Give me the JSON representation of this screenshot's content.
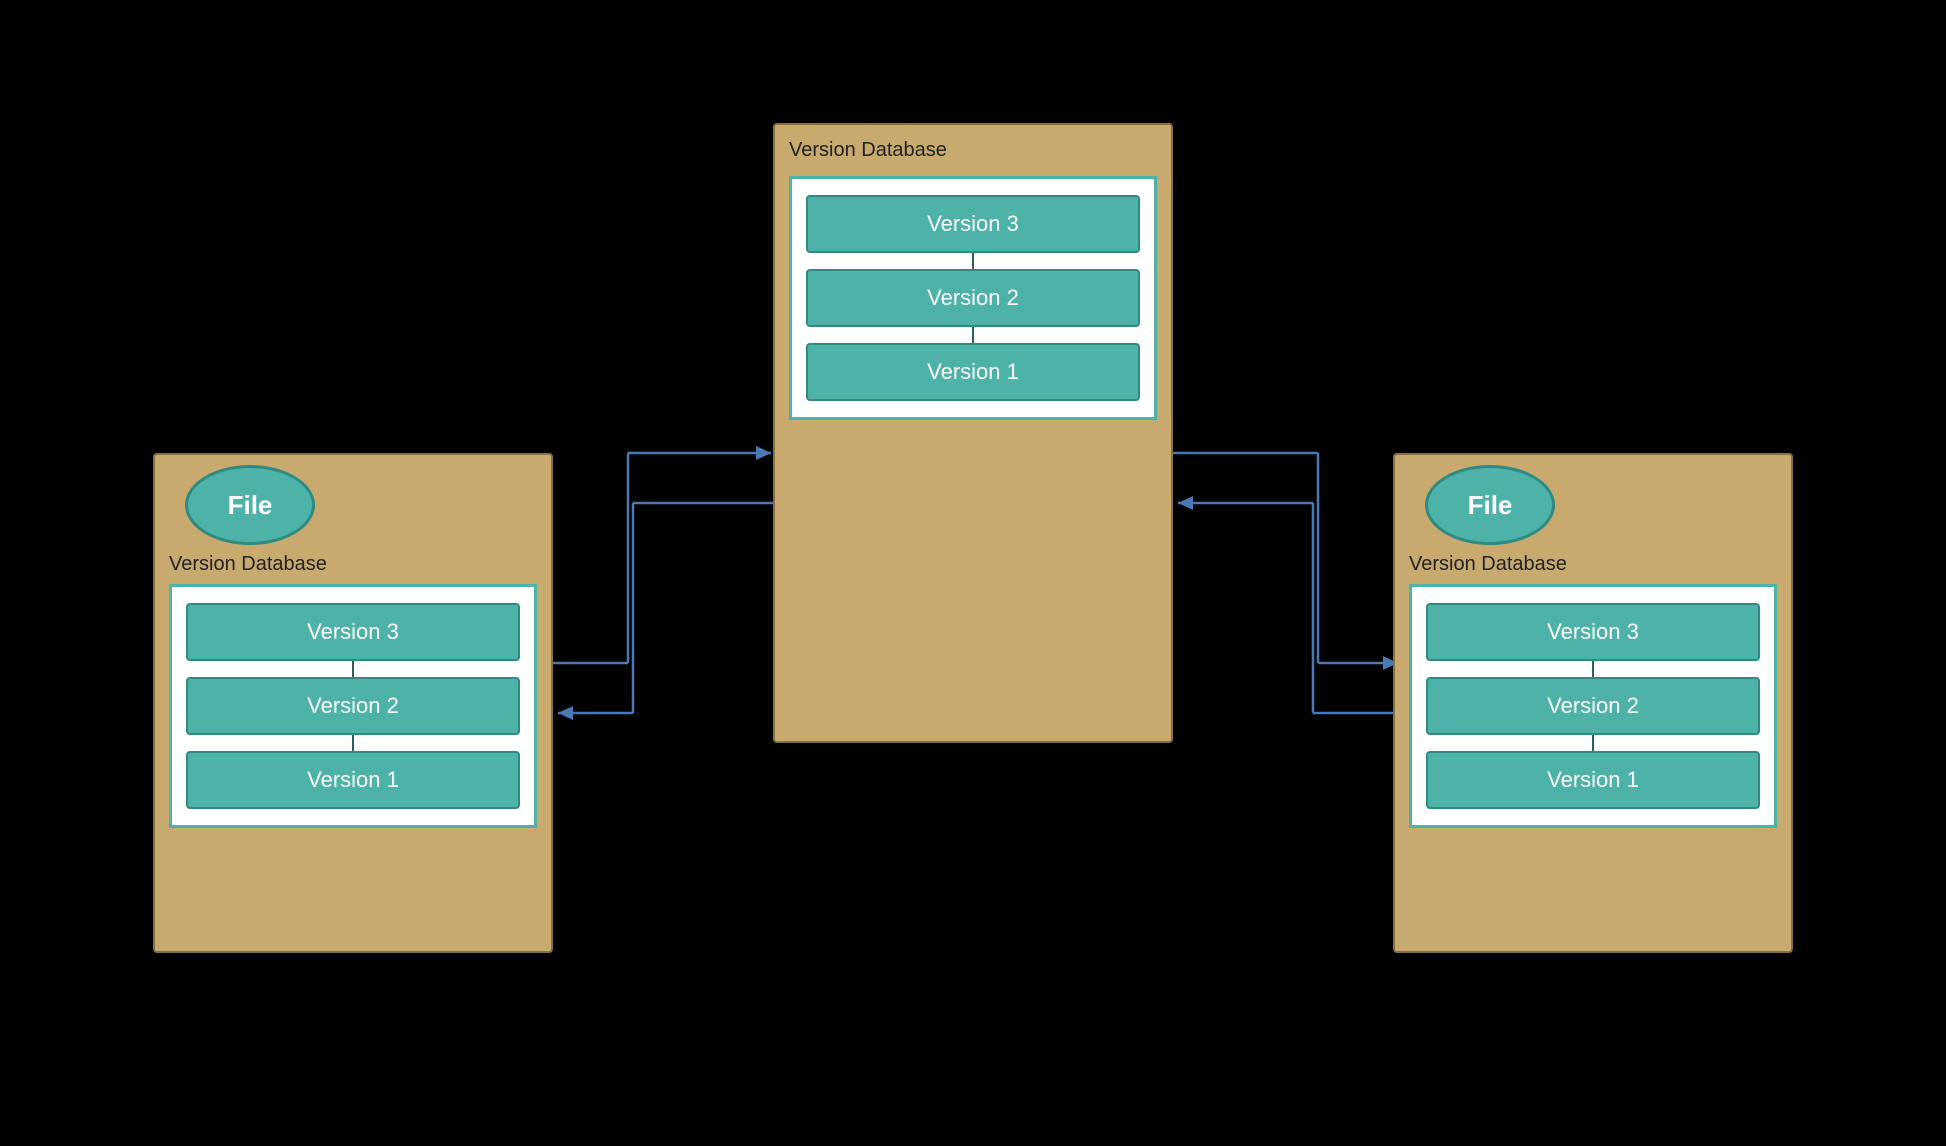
{
  "diagram": {
    "center": {
      "title": "Version Database",
      "versions": [
        "Version 3",
        "Version 2",
        "Version 1"
      ]
    },
    "left": {
      "file_label": "File",
      "vdb_label": "Version Database",
      "versions": [
        "Version 3",
        "Version 2",
        "Version 1"
      ]
    },
    "right": {
      "file_label": "File",
      "vdb_label": "Version Database",
      "versions": [
        "Version 3",
        "Version 2",
        "Version 1"
      ]
    }
  },
  "colors": {
    "box_bg": "#c8a96e",
    "box_border": "#8a7040",
    "teal": "#4db3a8",
    "teal_dark": "#2e8a82",
    "white": "#ffffff",
    "connector": "#2a6060",
    "arrow": "#4a7ab5"
  }
}
